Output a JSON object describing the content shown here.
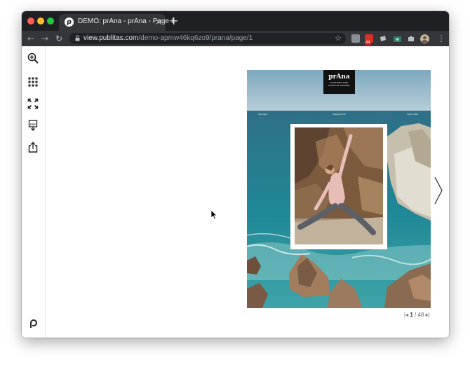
{
  "browser": {
    "tab_title": "DEMO: prAna - prAna - Page 1",
    "url_domain": "view.publitas.com",
    "url_path": "/demo-apmw46kq6zo9/prana/page/1",
    "extension_badge": "44"
  },
  "cover": {
    "brand": "prAna",
    "tagline_line1": "CLOTHING FOR",
    "tagline_line2": "POSITIVE CHANGE",
    "label_left": "Synergies",
    "label_center": "Category/5.23",
    "label_right": "Spring 2019"
  },
  "pager": {
    "current": "1",
    "separator": " / ",
    "total": "48"
  }
}
